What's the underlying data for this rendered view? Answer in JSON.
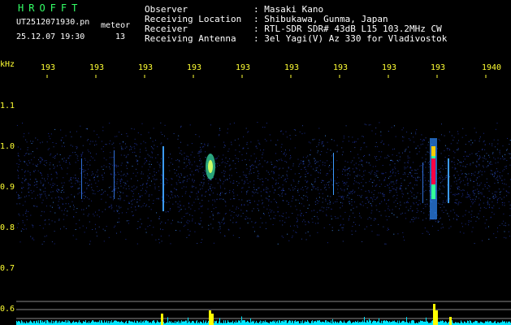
{
  "app": {
    "name": "HROFFT",
    "filename": "UT2512071930.pn",
    "tag": "meteor",
    "datetime": "25.12.07 19:30",
    "count": "13"
  },
  "info": {
    "rows": [
      {
        "label": "Observer",
        "value": ": Masaki Kano"
      },
      {
        "label": "Receiving Location",
        "value": ": Shibukawa, Gunma, Japan"
      },
      {
        "label": "Receiver",
        "value": ": RTL-SDR SDR# 43dB L15 103.2MHz CW"
      },
      {
        "label": "Receiving Antenna",
        "value": ": 3el Yagi(V) Az 330 for Vladivostok"
      }
    ]
  },
  "axis": {
    "unit": "kHz",
    "y_ticks": [
      "1.1",
      "1.0",
      "0.9",
      "0.8",
      "0.7",
      "0.6"
    ],
    "x_ticks": [
      "193",
      "193",
      "193",
      "193",
      "193",
      "193",
      "193",
      "193",
      "193",
      "1940"
    ]
  },
  "colors": {
    "background": "#000000",
    "label_yellow": "#ffff33",
    "title_green": "#33ff66",
    "noise_blue": "#1a2a8a",
    "hot_red": "#ff0044",
    "level_cyan": "#00e5ff",
    "meter_yellow": "#ffff00"
  }
}
